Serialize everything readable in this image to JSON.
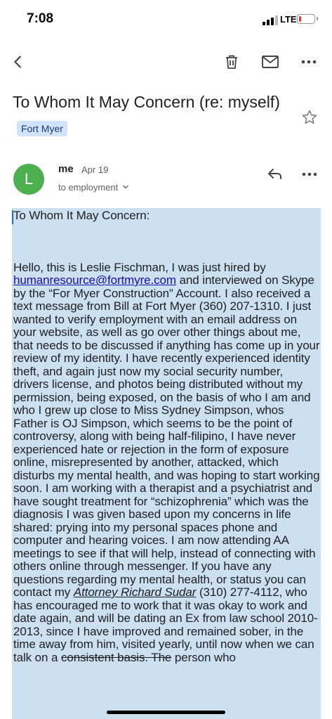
{
  "status_bar": {
    "time": "7:08",
    "network": "LTE",
    "battery_level": 0.15,
    "battery_color": "#e53935"
  },
  "toolbar": {
    "back_icon": "chevron-left-icon",
    "delete_icon": "trash-icon",
    "mark_unread_icon": "mail-icon",
    "more_icon": "more-horizontal-icon"
  },
  "subject": {
    "text": "To Whom It May Concern (re: myself)",
    "label": "Fort Myer",
    "star_icon": "star-outline-icon"
  },
  "sender": {
    "avatar_letter": "L",
    "avatar_color": "#4caf50",
    "name": "me",
    "date": "Apr 19",
    "to": "to employment",
    "reply_icon": "reply-icon",
    "more_icon": "more-horizontal-icon"
  },
  "body": {
    "greeting": "To Whom It May Concern:",
    "p1_a": "Hello, this is Leslie Fischman, I was just hired by ",
    "email_link": "humanresource@fortmyre.com",
    "p1_b": " and interviewed on Skype by the “For Myer Construction” Account. I also received a text message from Bill at Fort Myer (360) 207-1310. I just wanted to verify employment with an email address on your website, as well as go over other things about me, that needs to be discussed if anything has come up in your review of my identity. I have recently experienced identity theft, and again just now my social security number, drivers license, and photos being distributed without my permission, being exposed, on the basis of who I am and who I grew up close to Miss Sydney Simpson, whos Father is OJ Simpson, which seems to be the point of controversy, along with being half-filipino, I have never experienced hate or rejection in the form of exposure online, misrepresented by another, attacked, which disturbs my mental health, and was hoping to start working soon. I am working with a therapist and a psychiatrist and have sought treatment for “schizophrenia” which was the diagnosis I was given based upon my concerns in life shared: prying into my personal spaces phone and computer and hearing voices. I am now attending AA meetings to see if that will help, instead of connecting with others online through messenger. If you have any questions regarding my mental health, or status you can contact my ",
    "attorney_link": "Attorney Richard Sudar",
    "p1_c": " (310) 277-4112, who has encouraged me to work that it was okay to work and date again, and will be dating an Ex from law school 2010-2013, since I have improved and remained sober, in the time away from him, visited yearly, until now when we can talk on a ",
    "p1_strike": "consistent basis. The",
    "p1_d": " person who"
  }
}
